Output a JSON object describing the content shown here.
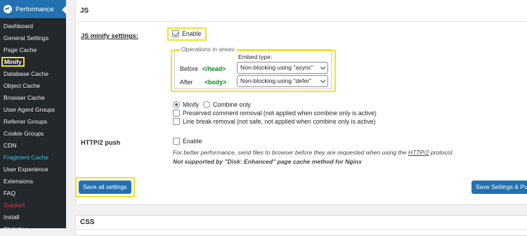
{
  "sidebar": {
    "title": "Performance",
    "items": [
      {
        "label": "Dashboard",
        "style": "normal"
      },
      {
        "label": "General Settings",
        "style": "normal"
      },
      {
        "label": "Page Cache",
        "style": "normal"
      },
      {
        "label": "Minify",
        "style": "active"
      },
      {
        "label": "Database Cache",
        "style": "normal"
      },
      {
        "label": "Object Cache",
        "style": "normal"
      },
      {
        "label": "Browser Cache",
        "style": "normal"
      },
      {
        "label": "User Agent Groups",
        "style": "normal"
      },
      {
        "label": "Referrer Groups",
        "style": "normal"
      },
      {
        "label": "Cookie Groups",
        "style": "normal"
      },
      {
        "label": "CDN",
        "style": "normal"
      },
      {
        "label": "Fragment Cache",
        "style": "cyan"
      },
      {
        "label": "User Experience",
        "style": "normal"
      },
      {
        "label": "Extensions",
        "style": "normal"
      },
      {
        "label": "FAQ",
        "style": "normal"
      },
      {
        "label": "Support",
        "style": "red"
      },
      {
        "label": "Install",
        "style": "normal"
      },
      {
        "label": "Statistics",
        "style": "normal"
      }
    ]
  },
  "js_section": {
    "title": "JS",
    "minify_label": "JS minify settings:",
    "enable_label": "Enable",
    "enable_checked": true,
    "operations_legend": "Operations in areas:",
    "embed_type_label": "Embed type:",
    "before_label": "Before",
    "before_tag": "</head>",
    "before_select": "Non-blocking using \"async\"",
    "after_label": "After",
    "after_tag": "<body>",
    "after_select": "Non-blocking using \"defer\"",
    "minify_radio": "Minify",
    "combine_radio": "Combine only",
    "preserved_comment": "Preserved comment removal (not applied when combine only is active)",
    "line_break": "Line break removal (not safe, not applied when combine only is active)",
    "http2_label": "HTTP/2 push",
    "http2_enable": "Enable",
    "http2_desc_pre": "For better performance, send files to browser before they are requested when using the ",
    "http2_desc_link": "HTTP/2",
    "http2_desc_post": " protocol.",
    "http2_note": "Not supported by \"Disk: Enhanced\" page cache method for Nginx",
    "save_all": "Save all settings",
    "save_purge": "Save Settings & Purge Caches"
  },
  "css_section": {
    "title": "CSS"
  },
  "colors": {
    "sidebar_bg": "#23282d",
    "accent": "#2271b1",
    "highlight": "#f2e22a",
    "tag_green": "#008a20"
  }
}
